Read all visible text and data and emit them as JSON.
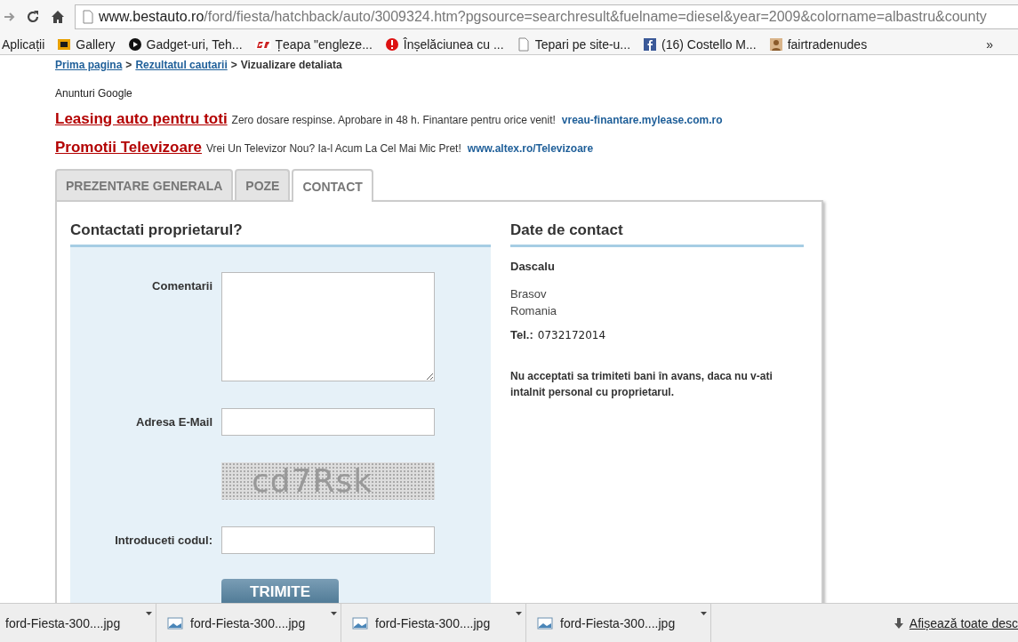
{
  "browser": {
    "url_host": "www.bestauto.ro",
    "url_path": "/ford/fiesta/hatchback/auto/3009324.htm?pgsource=searchresult&fuelname=diesel&year=2009&colorname=albastru&county",
    "bookmarks": [
      {
        "kind": "apps",
        "label": "Aplicații"
      },
      {
        "kind": "gallery",
        "label": "Gallery"
      },
      {
        "kind": "play",
        "label": "Gadget-uri, Teh..."
      },
      {
        "kind": "gb",
        "label": "Țeapa \"engleze..."
      },
      {
        "kind": "alert",
        "label": "Înșelăciunea cu ..."
      },
      {
        "kind": "page",
        "label": "Tepari pe site-u..."
      },
      {
        "kind": "facebook",
        "label": "(16) Costello M..."
      },
      {
        "kind": "person",
        "label": "fairtradenudes"
      }
    ],
    "more": "»"
  },
  "breadcrumb": {
    "links": [
      "Prima pagina",
      "Rezultatul cautarii"
    ],
    "separator": ">",
    "current": "Vizualizare detaliata"
  },
  "ads": {
    "heading": "Anunturi Google",
    "items": [
      {
        "title": "Leasing auto pentru toti",
        "text": "Zero dosare respinse. Aprobare in  48 h. Finantare pentru orice venit!",
        "url": "vreau-finantare.mylease.com.ro"
      },
      {
        "title": "Promotii Televizoare",
        "text": "Vrei Un Televizor Nou? Ia-l Acum La Cel Mai Mic Pret!",
        "url": "www.altex.ro/Televizoare"
      }
    ]
  },
  "tabs": [
    {
      "label": "PREZENTARE GENERALA",
      "selected": false
    },
    {
      "label": "POZE",
      "selected": false
    },
    {
      "label": "CONTACT",
      "selected": true
    }
  ],
  "form": {
    "title": "Contactati proprietarul?",
    "comment_label": "Comentarii",
    "email_label": "Adresa E-Mail",
    "captcha": "cd7Rsk",
    "code_label": "Introduceti codul:",
    "submit": "TRIMITE"
  },
  "contact": {
    "title": "Date de contact",
    "name": "Dascalu",
    "city": "Brasov",
    "country": "Romania",
    "phone_label": "Tel.:",
    "phone": "0732172014",
    "warning": "Nu acceptati sa trimiteti bani în avans, daca nu v-ati intalnit personal cu proprietarul."
  },
  "downloads": {
    "items": [
      {
        "name": "ford-Fiesta-300....jpg",
        "icon": false
      },
      {
        "name": "ford-Fiesta-300....jpg",
        "icon": true
      },
      {
        "name": "ford-Fiesta-300....jpg",
        "icon": true
      },
      {
        "name": "ford-Fiesta-300....jpg",
        "icon": true
      }
    ],
    "show_all": "Afișează toate desc"
  }
}
